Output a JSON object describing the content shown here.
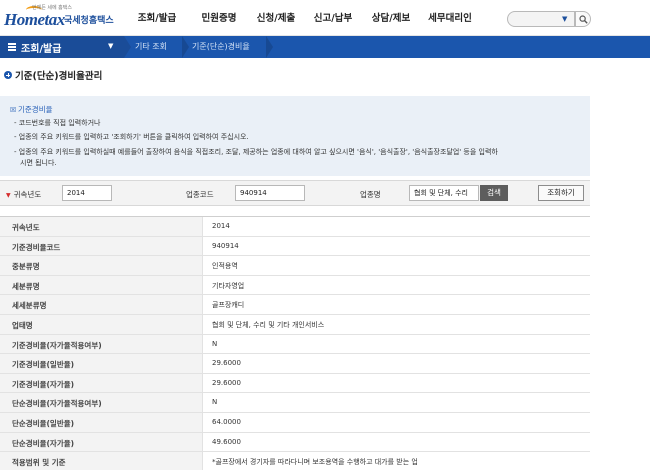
{
  "header": {
    "logo_tagline": "언제든 세에 홈택스",
    "logo_home": "Hometax",
    "logo_suffix": "국세청홈택스",
    "gnb": [
      "조회/발급",
      "민원증명",
      "신청/제출",
      "신고/납부",
      "상담/제보",
      "세무대리인"
    ],
    "search_placeholder": ""
  },
  "navbar": {
    "menu_label": "조회/발급",
    "breadcrumbs": [
      "기타 조회",
      "기준(단순)경비율"
    ]
  },
  "page": {
    "title": "기준(단순)경비율관리"
  },
  "infobox": {
    "heading": "기준경비율",
    "lines": [
      "- 코드번호를 직접 입력하거나",
      "- 업종의 주요 키워드를 입력하고 '조회하기' 버튼을 클릭하여 입력하여 주십시오.",
      "- 업종의 주요 키워드를 입력하실때 예를들어 출장하여 음식을 직접조리, 조달, 제공하는 업종에 대하여 알고 싶으시면 '음식', '음식출장', '음식출장조달업' 등을 입력하",
      "시면 됩니다."
    ]
  },
  "form": {
    "year_label": "귀속년도",
    "year_value": "2014",
    "code_label": "업종코드",
    "code_value": "940914",
    "name_label": "업종명",
    "name_value": "협회 및 단체, 수리",
    "search_button": "검색",
    "submit_button": "조회하기"
  },
  "result": {
    "rows": [
      {
        "label": "귀속년도",
        "value": "2014"
      },
      {
        "label": "기준경비율코드",
        "value": "940914"
      },
      {
        "label": "중분류명",
        "value": "인적용역"
      },
      {
        "label": "세분류명",
        "value": "기타자영업"
      },
      {
        "label": "세세분류명",
        "value": "골프장캐디"
      },
      {
        "label": "업태명",
        "value": "협회 및 단체, 수리 및 기타 개인서비스"
      },
      {
        "label": "기준경비율(자가율적용여부)",
        "value": "N"
      },
      {
        "label": "기준경비율(일반율)",
        "value": "29.6000"
      },
      {
        "label": "기준경비율(자가율)",
        "value": "29.6000"
      },
      {
        "label": "단순경비율(자가율적용여부)",
        "value": "N"
      },
      {
        "label": "단순경비율(일반율)",
        "value": "64.0000"
      },
      {
        "label": "단순경비율(자가율)",
        "value": "49.6000"
      },
      {
        "label": "적용범위 및 기준",
        "value": "*골프장에서 경기자를 따라다니며 보조용역을 수행하고 대가를 받는 업"
      }
    ]
  },
  "colors": {
    "brand_blue": "#1b56ad",
    "nav_dark": "#1a4c98",
    "required_red": "#d42b2b"
  }
}
